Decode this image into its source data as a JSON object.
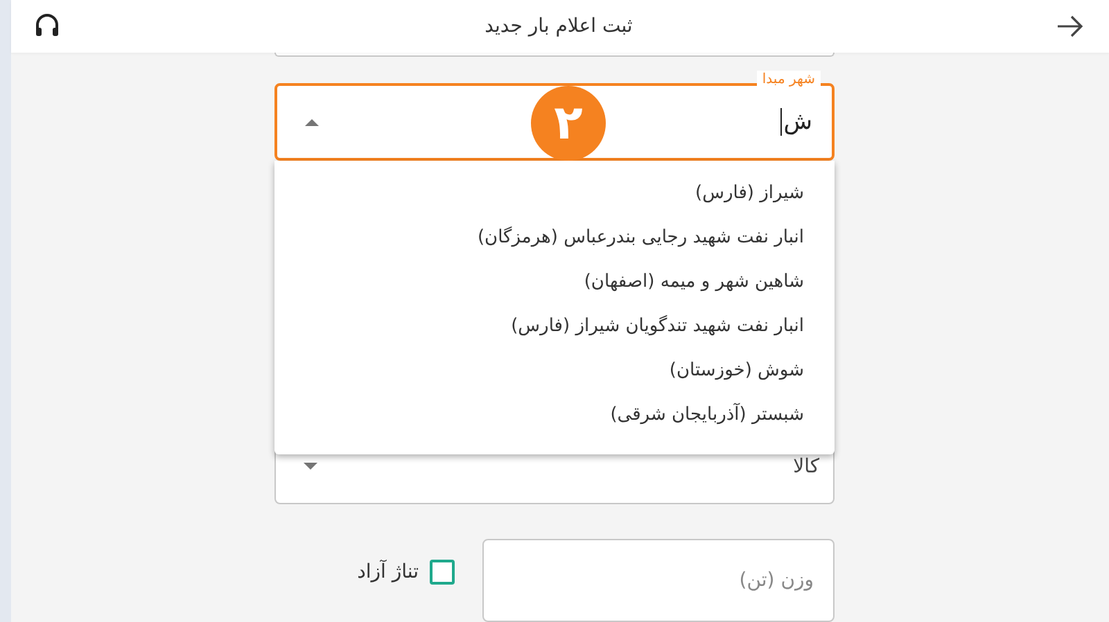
{
  "header": {
    "title": "ثبت اعلام بار جدید"
  },
  "origin_field": {
    "label": "شهر مبدا",
    "value": "ش",
    "focused": true
  },
  "step_badge": "۲",
  "suggestions": [
    "شیراز (فارس)",
    "انبار نفت شهید رجایی بندرعباس (هرمزگان)",
    "شاهین شهر و میمه (اصفهان)",
    "انبار نفت شهید تندگویان شیراز (فارس)",
    "شوش (خوزستان)",
    "شبستر (آذربایجان شرقی)"
  ],
  "cargo_field": {
    "value": "کالا"
  },
  "weight_field": {
    "placeholder": "وزن (تن)"
  },
  "free_tonnage": {
    "label": "تناژ آزاد",
    "checked": false
  }
}
